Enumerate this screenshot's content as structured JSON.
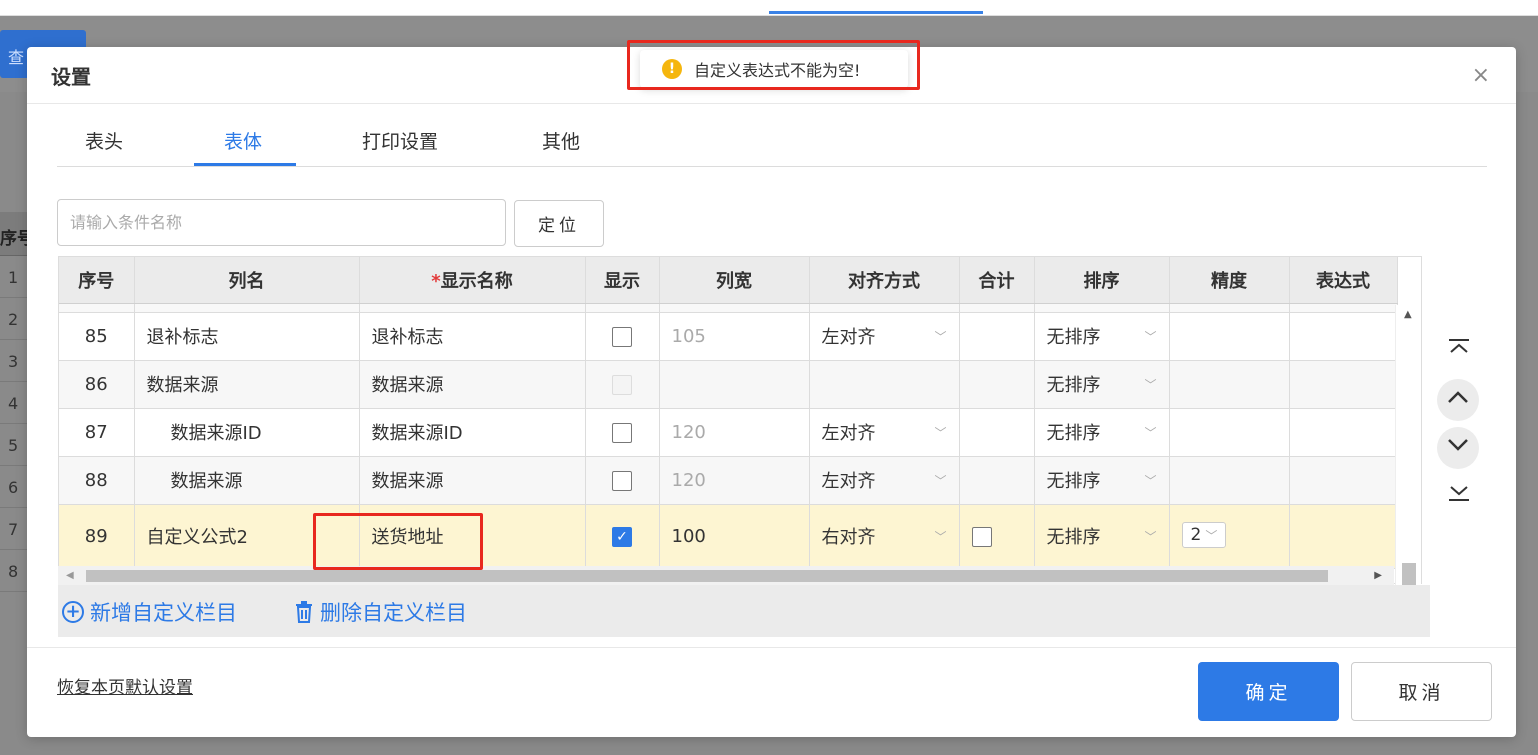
{
  "background": {
    "query_button": "查",
    "table_header": "序号",
    "rows": [
      "1",
      "2",
      "3",
      "4",
      "5",
      "6",
      "7",
      "8"
    ]
  },
  "toast": {
    "message": "自定义表达式不能为空!"
  },
  "dialog": {
    "title": "设置",
    "close": "×",
    "tabs": [
      "表头",
      "表体",
      "打印设置",
      "其他"
    ],
    "active_tab": "表体",
    "search": {
      "placeholder": "请输入条件名称",
      "value": ""
    },
    "locate_button": "定位",
    "grid": {
      "headers": [
        "序号",
        "列名",
        "显示名称",
        "显示",
        "列宽",
        "对齐方式",
        "合计",
        "排序",
        "精度",
        "表达式"
      ],
      "required_mark": "*",
      "rows": [
        {
          "no": "85",
          "name": "退补标志",
          "display": "退补标志",
          "show": false,
          "width": "105",
          "align": "左对齐",
          "total": "",
          "sort": "无排序",
          "precision": ""
        },
        {
          "no": "86",
          "name": "数据来源",
          "display": "数据来源",
          "show": false,
          "width": "",
          "align": "",
          "total": "",
          "sort": "无排序",
          "precision": ""
        },
        {
          "no": "87",
          "name": "数据来源ID",
          "display": "数据来源ID",
          "show": false,
          "width": "120",
          "align": "左对齐",
          "total": "",
          "sort": "无排序",
          "precision": ""
        },
        {
          "no": "88",
          "name": "数据来源",
          "display": "数据来源",
          "show": false,
          "width": "120",
          "align": "左对齐",
          "total": "",
          "sort": "无排序",
          "precision": ""
        },
        {
          "no": "89",
          "name": "自定义公式2",
          "display": "送货地址",
          "show": true,
          "width": "100",
          "align": "右对齐",
          "total": "",
          "sort": "无排序",
          "precision": "2"
        }
      ]
    },
    "add_custom": "新增自定义栏目",
    "delete_custom": "删除自定义栏目",
    "restore_defaults": "恢复本页默认设置",
    "ok_button": "确定",
    "cancel_button": "取消"
  },
  "colors": {
    "accent": "#2d7ae6",
    "highlight_row": "#fdf5d2",
    "warning": "#f5b60e",
    "annotation": "#e8281e"
  }
}
